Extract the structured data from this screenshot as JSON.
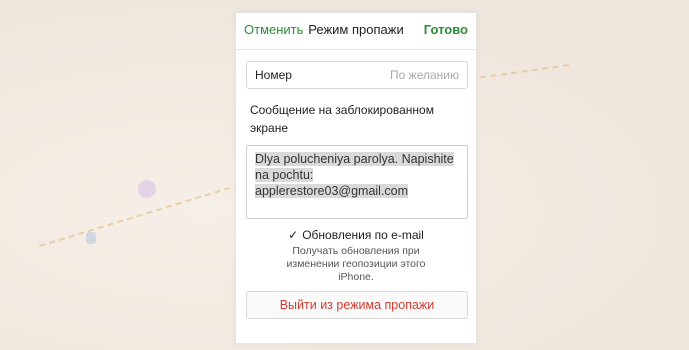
{
  "nav": {
    "cancel_label": "Отменить",
    "title": "Режим пропажи",
    "done_label": "Готово"
  },
  "phone_field": {
    "label": "Номер",
    "placeholder": "По желанию"
  },
  "message": {
    "label": "Сообщение на заблокированном экране",
    "text": "Dlya polucheniya parolya. Napishite na pochtu: applerestore03@gmail.com"
  },
  "email_updates": {
    "checked": true,
    "label": "Обновления по e-mail",
    "description": "Получать обновления при изменении геопозиции этого iPhone."
  },
  "exit_button": {
    "label": "Выйти из режима пропажи"
  },
  "colors": {
    "accent_green": "#2e8b3a",
    "danger_red": "#d23a2f"
  },
  "icons": {
    "check": "checkmark-icon",
    "map_pin": "map-pin-icon"
  }
}
